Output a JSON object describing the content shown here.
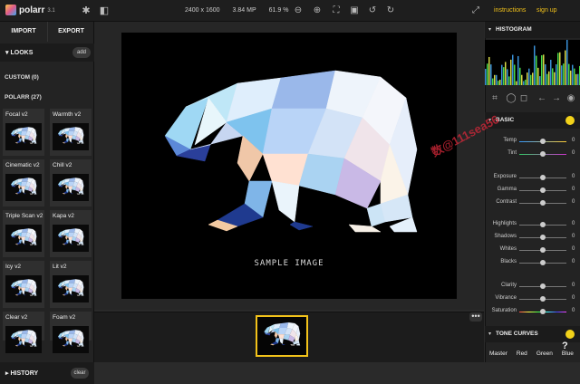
{
  "app": {
    "name": "polarr",
    "version": "3.1"
  },
  "top_info": {
    "dimensions": "2400 x 1600",
    "megapixels": "3.84 MP",
    "zoom": "61.9 %"
  },
  "top_links": {
    "instructions": "instructions",
    "signup": "sign up"
  },
  "left": {
    "import_label": "IMPORT",
    "export_label": "EXPORT",
    "looks_label": "LOOKS",
    "add_label": "add",
    "custom_label": "CUSTOM (0)",
    "polarr_label": "POLARR (27)",
    "looks": [
      "Focal v2",
      "Warmth v2",
      "Cinematic v2",
      "Chill v2",
      "Triple Scan v2",
      "Kapa v2",
      "Icy v2",
      "Lit v2",
      "Clear v2",
      "Foam v2"
    ],
    "history_label": "HISTORY",
    "clear_label": "clear"
  },
  "canvas": {
    "caption": "SAMPLE IMAGE",
    "more_label": "•••"
  },
  "right": {
    "histogram_label": "HISTOGRAM",
    "basic_label": "BASIC",
    "sliders": [
      {
        "label": "Temp",
        "value": "0",
        "pos": 0.5
      },
      {
        "label": "Tint",
        "value": "0",
        "pos": 0.5
      },
      {
        "label": "Exposure",
        "value": "0",
        "pos": 0.5
      },
      {
        "label": "Gamma",
        "value": "0",
        "pos": 0.5
      },
      {
        "label": "Contrast",
        "value": "0",
        "pos": 0.5
      },
      {
        "label": "Highlights",
        "value": "0",
        "pos": 0.5
      },
      {
        "label": "Shadows",
        "value": "0",
        "pos": 0.5
      },
      {
        "label": "Whites",
        "value": "0",
        "pos": 0.5
      },
      {
        "label": "Blacks",
        "value": "0",
        "pos": 0.5
      },
      {
        "label": "Clarity",
        "value": "0",
        "pos": 0.5
      },
      {
        "label": "Vibrance",
        "value": "0",
        "pos": 0.5
      },
      {
        "label": "Saturation",
        "value": "0",
        "pos": 0.5
      }
    ],
    "tone_curves_label": "TONE CURVES",
    "curve_tabs": [
      "Master",
      "Red",
      "Green",
      "Blue"
    ]
  },
  "watermark": "数@111sea56",
  "colors": {
    "accent": "#f2c21a",
    "panel": "#232323",
    "canvas": "#000000"
  }
}
